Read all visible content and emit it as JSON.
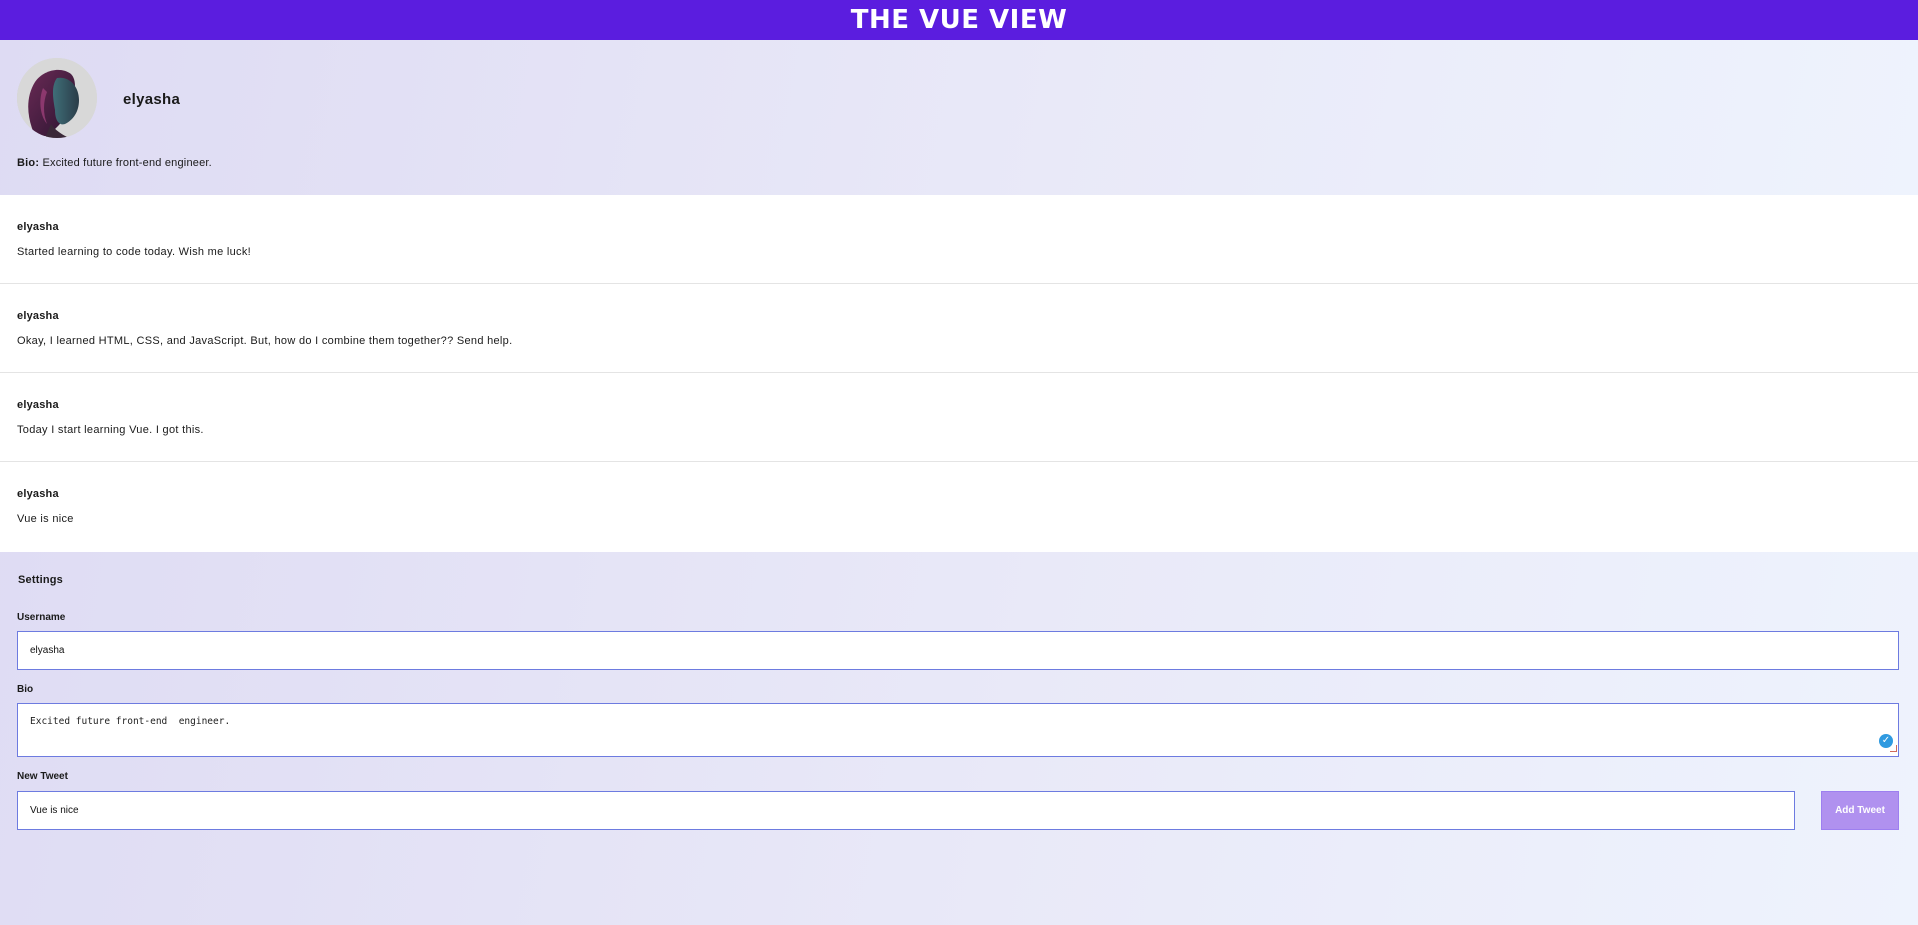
{
  "header": {
    "title": "THE VUE VIEW"
  },
  "profile": {
    "username": "elyasha",
    "bio_label": "Bio:",
    "bio_text": "Excited future front-end engineer."
  },
  "tweets": [
    {
      "author": "elyasha",
      "text": "Started learning to code today. Wish me luck!"
    },
    {
      "author": "elyasha",
      "text": "Okay, I learned HTML, CSS, and JavaScript. But, how do I combine them together?? Send help."
    },
    {
      "author": "elyasha",
      "text": "Today I start learning Vue. I got this."
    },
    {
      "author": "elyasha",
      "text": "Vue is nice"
    }
  ],
  "settings": {
    "title": "Settings",
    "username_label": "Username",
    "username_value": "elyasha",
    "bio_label": "Bio",
    "bio_value": "Excited future front-end  engineer.",
    "new_tweet_label": "New Tweet",
    "new_tweet_value": "Vue is nice",
    "add_button_label": "Add Tweet"
  },
  "colors": {
    "header_bg": "#5b1ddf",
    "button_bg": "#b091ef",
    "input_border": "#6d7be0"
  },
  "icons": {
    "avatar": "profile-photo",
    "grammar_badge": "check-circle-icon"
  }
}
